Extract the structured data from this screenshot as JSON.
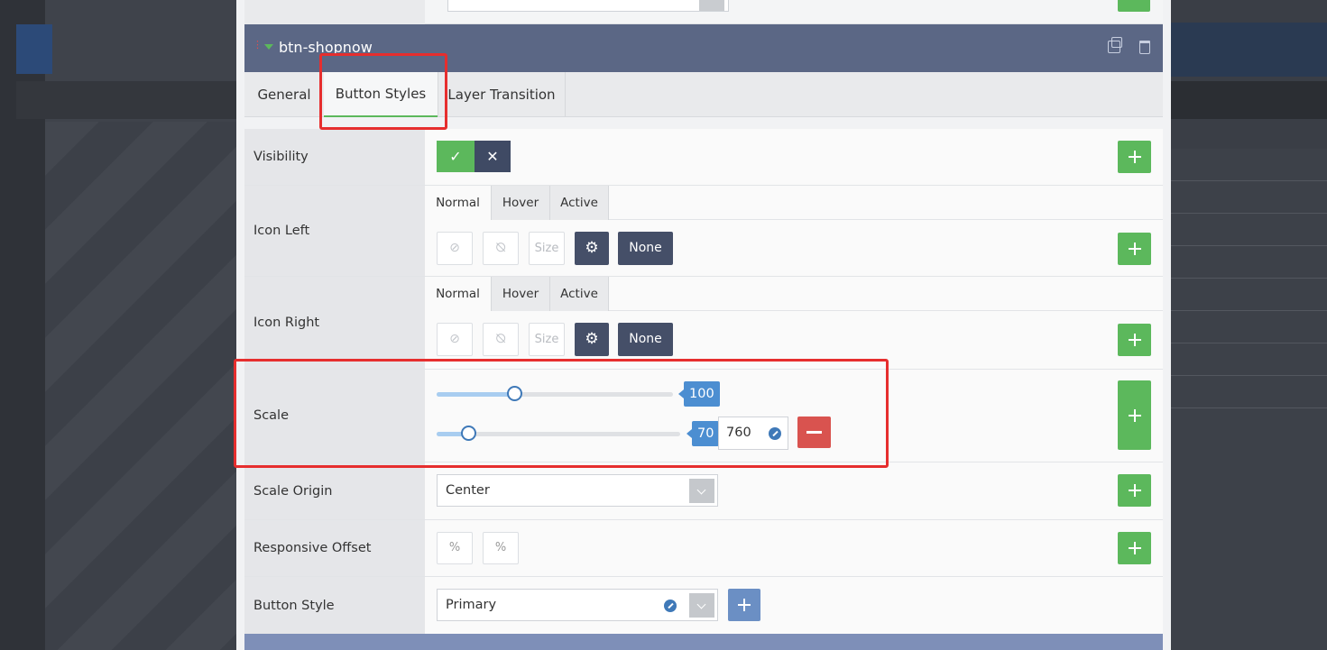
{
  "layer": {
    "name": "btn-shopnow"
  },
  "tabs": [
    "General",
    "Button Styles",
    "Layer Transition"
  ],
  "active_tab": "Button Styles",
  "rows": {
    "visibility": {
      "label": "Visibility",
      "on_icon": "check-icon",
      "off_icon": "x-icon"
    },
    "icon_left": {
      "label": "Icon Left",
      "states": [
        "Normal",
        "Hover",
        "Active"
      ],
      "active_state": "Normal",
      "size_placeholder": "Size",
      "none_label": "None"
    },
    "icon_right": {
      "label": "Icon Right",
      "states": [
        "Normal",
        "Hover",
        "Active"
      ],
      "active_state": "Normal",
      "size_placeholder": "Size",
      "none_label": "None"
    },
    "scale": {
      "label": "Scale",
      "slider1_value": "100",
      "slider1_fraction": 0.33,
      "slider2_value": "70",
      "slider2_fraction": 0.13,
      "breakpoint_value": "760"
    },
    "scale_origin": {
      "label": "Scale Origin",
      "value": "Center"
    },
    "responsive_offset": {
      "label": "Responsive Offset",
      "unit1": "%",
      "unit2": "%"
    },
    "button_style": {
      "label": "Button Style",
      "value": "Primary"
    }
  },
  "colors": {
    "accent_green": "#5cb85c",
    "header_slate": "#5b6785",
    "danger_red": "#d9534f",
    "highlight_red": "#e62e2e",
    "slider_blue": "#4c8ed1"
  }
}
